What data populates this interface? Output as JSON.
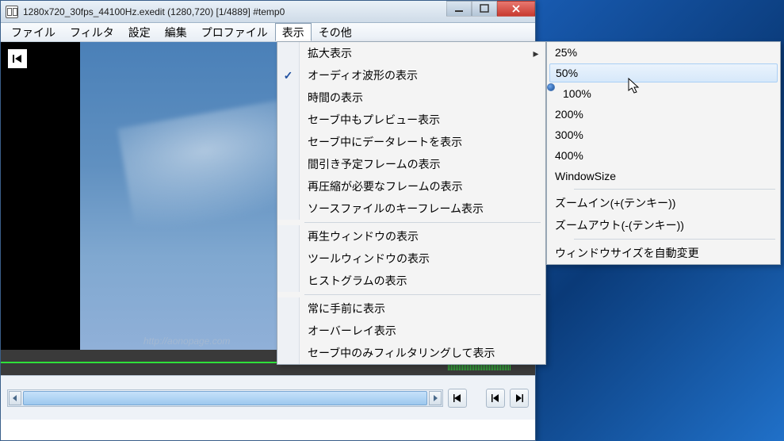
{
  "window": {
    "title": "1280x720_30fps_44100Hz.exedit (1280,720)  [1/4889]  #temp0"
  },
  "menubar": {
    "items": [
      "ファイル",
      "フィルタ",
      "設定",
      "編集",
      "プロファイル",
      "表示",
      "その他"
    ],
    "open_index": 5
  },
  "dropdown": {
    "groups": [
      [
        {
          "label": "拡大表示",
          "has_submenu": true
        },
        {
          "label": "オーディオ波形の表示",
          "checked": true
        },
        {
          "label": "時間の表示"
        },
        {
          "label": "セーブ中もプレビュー表示"
        },
        {
          "label": "セーブ中にデータレートを表示"
        },
        {
          "label": "間引き予定フレームの表示"
        },
        {
          "label": "再圧縮が必要なフレームの表示"
        },
        {
          "label": "ソースファイルのキーフレーム表示"
        }
      ],
      [
        {
          "label": "再生ウィンドウの表示"
        },
        {
          "label": "ツールウィンドウの表示"
        },
        {
          "label": "ヒストグラムの表示"
        }
      ],
      [
        {
          "label": "常に手前に表示"
        },
        {
          "label": "オーバーレイ表示"
        },
        {
          "label": "セーブ中のみフィルタリングして表示"
        }
      ]
    ]
  },
  "submenu": {
    "groups": [
      [
        {
          "label": "25%"
        },
        {
          "label": "50%",
          "hover": true
        },
        {
          "label": "100%",
          "radio": true
        },
        {
          "label": "200%"
        },
        {
          "label": "300%"
        },
        {
          "label": "400%"
        },
        {
          "label": "WindowSize"
        }
      ],
      [
        {
          "label": "ズームイン(+(テンキー))"
        },
        {
          "label": "ズームアウト(-(テンキー))"
        }
      ],
      [
        {
          "label": "ウィンドウサイズを自動変更"
        }
      ]
    ]
  },
  "preview": {
    "watermark": "http://aonopage.com"
  }
}
